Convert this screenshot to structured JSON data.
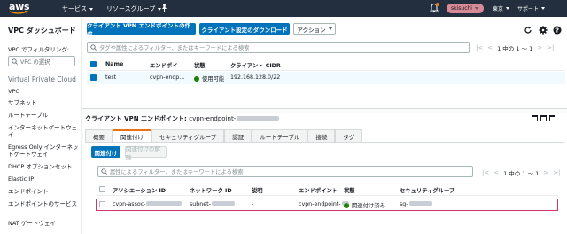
{
  "topnav": {
    "logo": "aws",
    "services": "サービス",
    "resource_groups": "リソースグループ",
    "username": "skisuchi",
    "region": "東京",
    "support": "サポート"
  },
  "sidebar": {
    "title": "VPC ダッシュボード",
    "filter_label": "VPC でフィルタリング:",
    "vpc_select_placeholder": "VPC の選択",
    "section": "Virtual Private Cloud",
    "items": [
      "VPC",
      "サブネット",
      "ルートテーブル",
      "インターネットゲートウェイ",
      "Egress Only インターネットゲートウェイ",
      "DHCP オプションセット",
      "Elastic IP",
      "エンドポイント",
      "エンドポイントのサービス",
      "NAT ゲートウェイ"
    ]
  },
  "toolbar": {
    "create_endpoint": "クライアント VPN エンドポイントの作成",
    "download_config": "クライアント設定のダウンロード",
    "actions": "アクション"
  },
  "top_table": {
    "search_placeholder": "タグや属性によるフィルター、またはキーワードによる検索",
    "pager": "1 中の 1 ～ 1",
    "columns": [
      "Name",
      "エンドポイ",
      "状態",
      "クライアント CIDR"
    ],
    "rows": [
      {
        "name": "test",
        "endpoint": "cvpn-endp...",
        "status": "使用可能",
        "cidr": "192.168.128.0/22"
      }
    ]
  },
  "detail": {
    "title": "クライアント VPN エンドポイント:",
    "endpoint_id": "cvpn-endpoint-",
    "tabs": [
      "概要",
      "関連付け",
      "セキュリティグループ",
      "認証",
      "ルートテーブル",
      "接続",
      "タグ"
    ],
    "associate_button": "関連付け",
    "disassociate_button": "関連付けの解除",
    "search_placeholder": "属性によるフィルター、またはキーワードによる検索",
    "pager": "1 中の 1 ～ 1",
    "columns": [
      "アソシエーション ID",
      "ネットワーク ID",
      "説明",
      "エンドポイント",
      "状態",
      "セキュリティグループ"
    ],
    "rows": [
      {
        "assoc_id": "cvpn-assoc-",
        "network_id": "subnet-",
        "desc": "-",
        "endpoint": "cvpn-endpoint-",
        "status": "関連付け済み",
        "sg": "sg-"
      }
    ]
  },
  "colors": {
    "nav_bg": "#232f3e",
    "primary": "#0073bb",
    "accent": "#ec7211",
    "success": "#1d8102",
    "highlight": "#d6336c"
  }
}
